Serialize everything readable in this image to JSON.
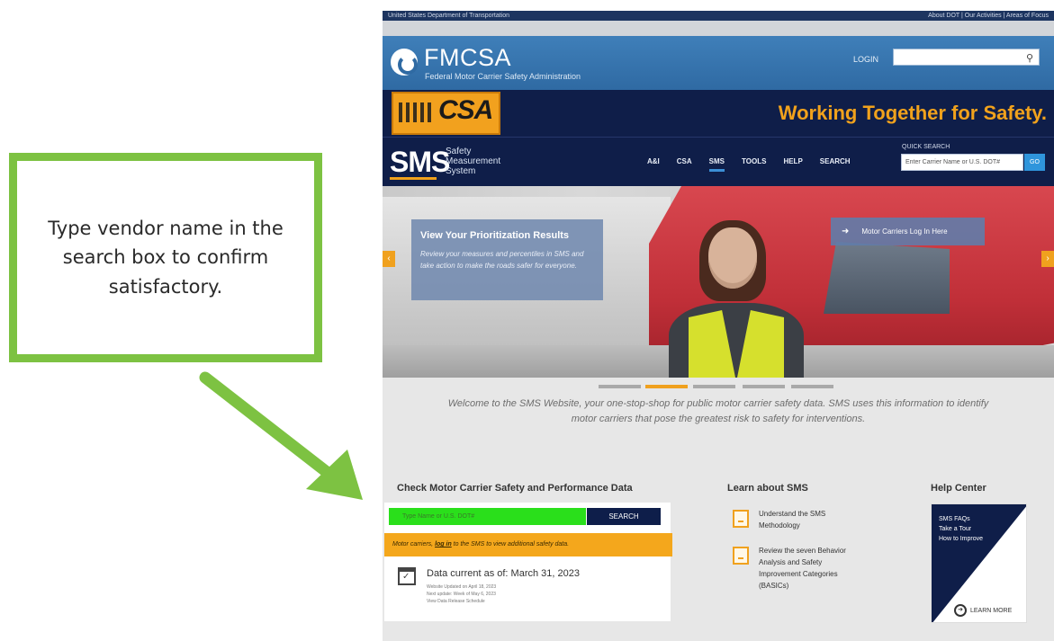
{
  "callout": {
    "text": "Type vendor name in the search box to confirm satisfactory."
  },
  "top_bar": {
    "agency": "United States Department of Transportation",
    "right_links": "About DOT | Our Activities | Areas of Focus"
  },
  "header": {
    "title": "FMCSA",
    "subtitle": "Federal Motor Carrier Safety Administration",
    "login": "LOGIN"
  },
  "banner": {
    "csa": "CSA",
    "tagline": "Working Together for Safety."
  },
  "nav": {
    "sms_abbr": "SMS",
    "sms_full": "Safety Measurement System",
    "items": [
      "A&I",
      "CSA",
      "SMS",
      "TOOLS",
      "HELP",
      "SEARCH"
    ],
    "quick_search_label": "QUICK SEARCH",
    "quick_search_placeholder": "Enter Carrier Name or U.S. DOT#",
    "go": "GO"
  },
  "hero": {
    "card_title": "View Your Prioritization Results",
    "card_text": "Review your measures and percentiles in SMS and take action to make the roads safer for everyone.",
    "mc_login": "Motor Carriers Log In Here",
    "left_arrow": "‹",
    "right_arrow": "›"
  },
  "welcome": "Welcome to the SMS Website, your one-stop-shop for public motor carrier safety data. SMS uses this information to identify motor carriers that pose the greatest risk to safety for interventions.",
  "carrier": {
    "title": "Check Motor Carrier Safety and Performance Data",
    "input_placeholder": "Type Name or U.S. DOT#",
    "search_button": "SEARCH",
    "notice_prefix": "Motor carriers, ",
    "notice_link": "log in",
    "notice_suffix": " to the SMS to view additional safety data.",
    "data_current": "Data current as of: March 31, 2023",
    "small_lines": [
      "Website Updated on April 18, 2023",
      "Next update: Week of May 6, 2023",
      "View Data Release Schedule"
    ]
  },
  "learn": {
    "title": "Learn about SMS",
    "items": [
      "Understand the SMS Methodology",
      "Review the seven Behavior Analysis and Safety Improvement Categories (BASICs)"
    ]
  },
  "help": {
    "title": "Help Center",
    "lines": [
      "SMS FAQs",
      "Take a Tour",
      "How to Improve"
    ],
    "learn_more": "LEARN MORE"
  },
  "colors": {
    "callout_green": "#7dc242",
    "navy": "#0f1e49",
    "accent_orange": "#f0a11e",
    "input_green": "#2adf1b"
  }
}
